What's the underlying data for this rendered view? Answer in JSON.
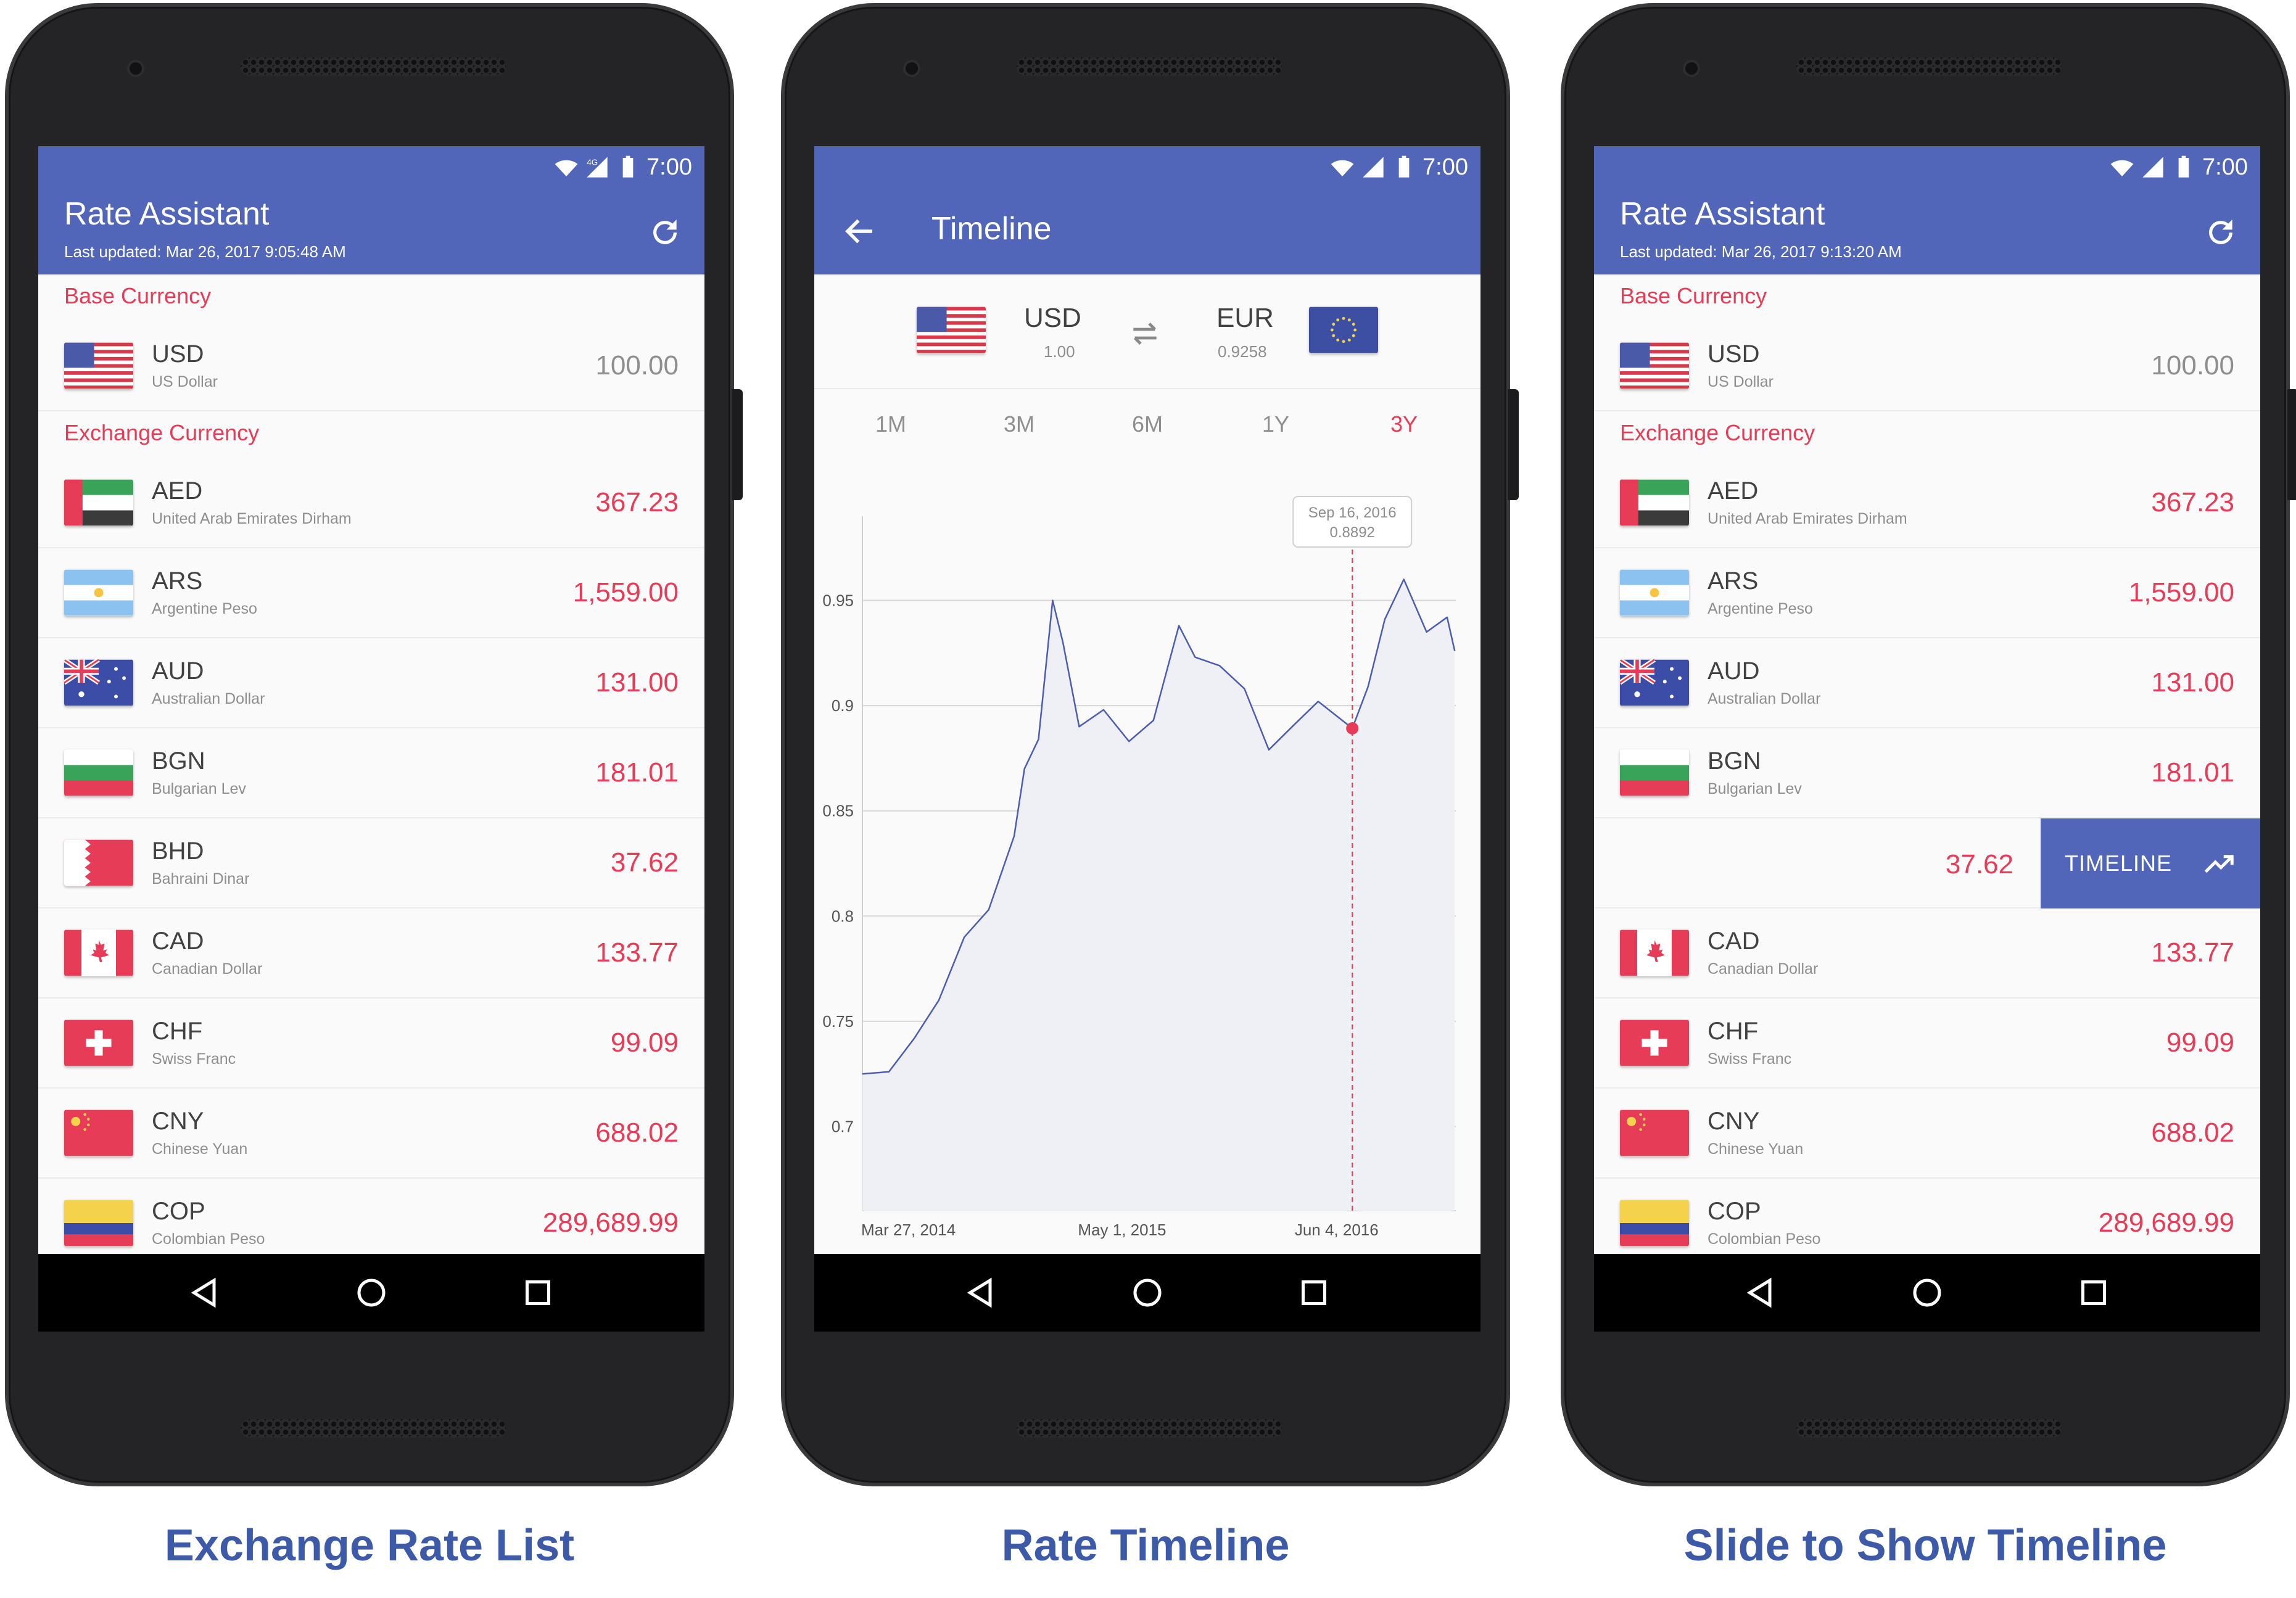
{
  "colors": {
    "primary": "#5166b8",
    "accent": "#e63c57",
    "caption": "#3c5aa8"
  },
  "status": {
    "time": "7:00",
    "network": "4G"
  },
  "phone1": {
    "title": "Rate Assistant",
    "last_updated": "Last updated: Mar 26, 2017 9:05:48 AM",
    "base_label": "Base Currency",
    "base": {
      "code": "USD",
      "name": "US Dollar",
      "value": "100.00"
    },
    "exchange_label": "Exchange Currency",
    "rows": [
      {
        "code": "AED",
        "name": "United Arab Emirates Dirham",
        "value": "367.23"
      },
      {
        "code": "ARS",
        "name": "Argentine Peso",
        "value": "1,559.00"
      },
      {
        "code": "AUD",
        "name": "Australian Dollar",
        "value": "131.00"
      },
      {
        "code": "BGN",
        "name": "Bulgarian Lev",
        "value": "181.01"
      },
      {
        "code": "BHD",
        "name": "Bahraini Dinar",
        "value": "37.62"
      },
      {
        "code": "CAD",
        "name": "Canadian Dollar",
        "value": "133.77"
      },
      {
        "code": "CHF",
        "name": "Swiss Franc",
        "value": "99.09"
      },
      {
        "code": "CNY",
        "name": "Chinese Yuan",
        "value": "688.02"
      },
      {
        "code": "COP",
        "name": "Colombian Peso",
        "value": "289,689.99"
      }
    ]
  },
  "phone2": {
    "title": "Timeline",
    "from": {
      "code": "USD",
      "value": "1.00"
    },
    "to": {
      "code": "EUR",
      "value": "0.9258"
    },
    "periods": [
      "1M",
      "3M",
      "6M",
      "1Y",
      "3Y"
    ],
    "active_period": "3Y",
    "tooltip": {
      "date": "Sep 16, 2016",
      "value": "0.8892"
    }
  },
  "phone3": {
    "title": "Rate Assistant",
    "last_updated": "Last updated: Mar 26, 2017 9:13:20 AM",
    "base_label": "Base Currency",
    "base": {
      "code": "USD",
      "name": "US Dollar",
      "value": "100.00"
    },
    "exchange_label": "Exchange Currency",
    "rows_top": [
      {
        "code": "AED",
        "name": "United Arab Emirates Dirham",
        "value": "367.23"
      },
      {
        "code": "ARS",
        "name": "Argentine Peso",
        "value": "1,559.00"
      },
      {
        "code": "AUD",
        "name": "Australian Dollar",
        "value": "131.00"
      },
      {
        "code": "BGN",
        "name": "Bulgarian Lev",
        "value": "181.01"
      }
    ],
    "swipe": {
      "value": "37.62",
      "button_label": "TIMELINE"
    },
    "rows_bottom": [
      {
        "code": "CAD",
        "name": "Canadian Dollar",
        "value": "133.77"
      },
      {
        "code": "CHF",
        "name": "Swiss Franc",
        "value": "99.09"
      },
      {
        "code": "CNY",
        "name": "Chinese Yuan",
        "value": "688.02"
      },
      {
        "code": "COP",
        "name": "Colombian Peso",
        "value": "289,689.99"
      }
    ]
  },
  "captions": [
    "Exchange Rate List",
    "Rate Timeline",
    "Slide to Show Timeline"
  ],
  "chart_data": {
    "type": "area",
    "series": [
      {
        "x": [
          "2014-03-27",
          "2014-05-15",
          "2014-07-01",
          "2014-08-15",
          "2014-10-01",
          "2014-11-15",
          "2015-01-01",
          "2015-01-20",
          "2015-02-15",
          "2015-03-13",
          "2015-04-01",
          "2015-05-01",
          "2015-06-15",
          "2015-08-01",
          "2015-09-15",
          "2015-11-01",
          "2015-12-01",
          "2016-01-15",
          "2016-03-01",
          "2016-04-15",
          "2016-06-01",
          "2016-07-15",
          "2016-09-16",
          "2016-10-15",
          "2016-11-15",
          "2016-12-20",
          "2017-01-31",
          "2017-03-10",
          "2017-03-24"
        ],
        "values": [
          0.725,
          0.726,
          0.742,
          0.76,
          0.79,
          0.803,
          0.838,
          0.87,
          0.884,
          0.95,
          0.93,
          0.89,
          0.898,
          0.883,
          0.893,
          0.938,
          0.923,
          0.919,
          0.908,
          0.879,
          0.891,
          0.902,
          0.8892,
          0.909,
          0.941,
          0.96,
          0.935,
          0.942,
          0.926
        ]
      }
    ],
    "ylim": [
      0.66,
      0.99
    ],
    "yticks": [
      0.95,
      0.9,
      0.85,
      0.8,
      0.75,
      0.7
    ],
    "xticks": [
      "Mar 27, 2014",
      "May 1, 2015",
      "Jun 4, 2016"
    ],
    "xlim": [
      "2014-03-27",
      "2017-03-26"
    ],
    "highlight": {
      "x": "2016-09-16",
      "y": 0.8892
    },
    "grid": true
  }
}
